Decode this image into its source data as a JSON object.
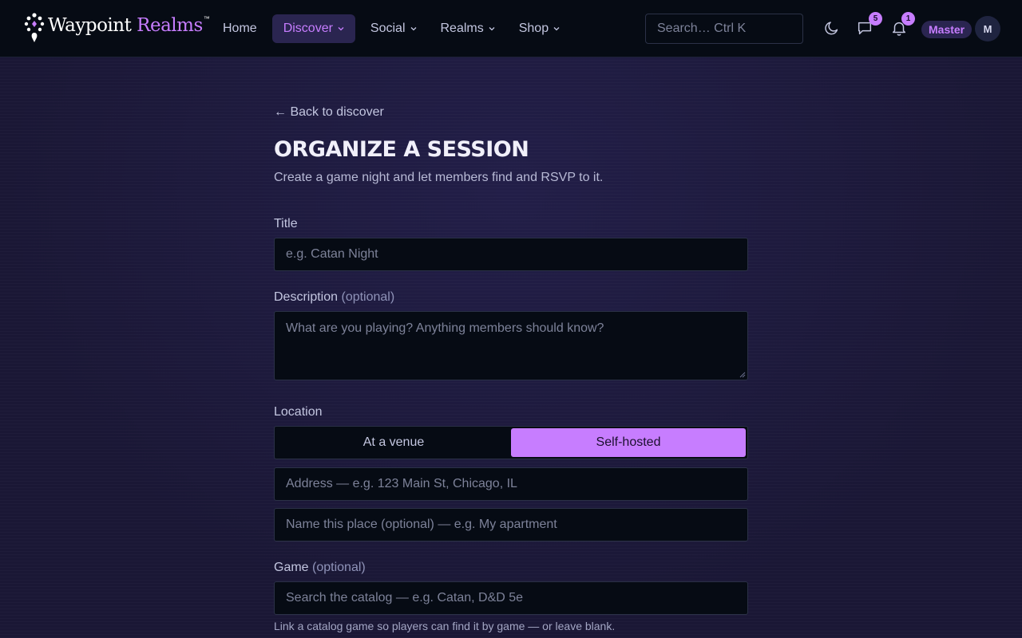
{
  "brand": {
    "name_part1": "Waypoint",
    "name_part2": "Realms",
    "trademark": "™",
    "accent_color": "#c77dff"
  },
  "nav": {
    "items": [
      {
        "label": "Home",
        "icon": "",
        "active": false
      },
      {
        "label": "Discover",
        "icon": "chevron-down-icon",
        "active": true
      },
      {
        "label": "Social",
        "icon": "chevron-down-icon",
        "active": false
      },
      {
        "label": "Realms",
        "icon": "chevron-down-icon",
        "active": false
      },
      {
        "label": "Shop",
        "icon": "chevron-down-icon",
        "active": false
      }
    ]
  },
  "search": {
    "placeholder": "Search…  Ctrl K"
  },
  "header_actions": {
    "theme_icon": "moon-icon",
    "messages_icon": "chat-icon",
    "messages_count": "5",
    "notifications_icon": "bell-icon",
    "notifications_count": "1",
    "role": "Master",
    "avatar_initial": "M"
  },
  "page": {
    "back_link": "← Back to discover",
    "title": "ORGANIZE A SESSION",
    "subtitle": "Create a game night and let members find and RSVP to it."
  },
  "form": {
    "title_label": "Title",
    "title_placeholder": "e.g. Catan Night",
    "description_label": "Description",
    "description_optional": "(optional)",
    "description_placeholder": "What are you playing? Anything members should know?",
    "location_label": "Location",
    "location_options": [
      "At a venue",
      "Self-hosted"
    ],
    "location_selected": "Self-hosted",
    "address_placeholder": "Address — e.g. 123 Main St, Chicago, IL",
    "place_name_placeholder": "Name this place (optional) — e.g. My apartment",
    "game_label": "Game",
    "game_optional": "(optional)",
    "game_placeholder": "Search the catalog — e.g. Catan, D&D 5e",
    "game_help": "Link a catalog game so players can find it by game — or leave blank."
  }
}
